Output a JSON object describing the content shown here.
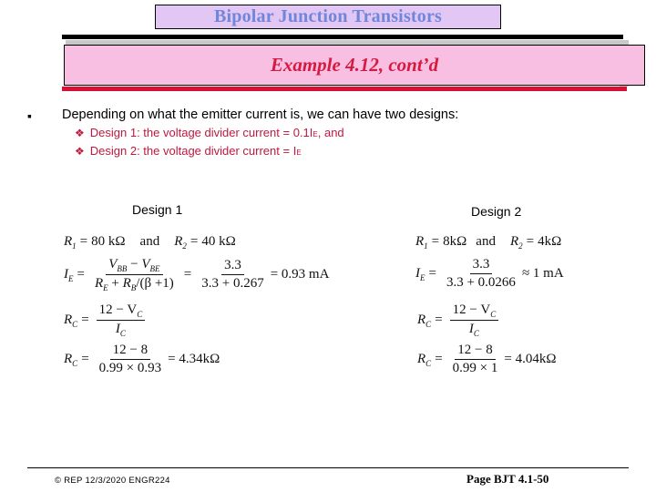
{
  "slide": {
    "title": "Bipolar Junction Transistors",
    "subtitle": "Example 4.12, cont’d",
    "colors": {
      "title_box_bg": "#e2c6f4",
      "title_text": "#6f86d9",
      "subtitle_box_bg": "#f9bfe3",
      "subtitle_text": "#d41a3f",
      "accent_rule": "#d90f33",
      "sub_bullet_text": "#c0183e"
    }
  },
  "body": {
    "main_bullet": {
      "icon": "square-bullet",
      "glyph": "▪",
      "text": "Depending on what the emitter current is, we can have two designs:"
    },
    "sub_bullets": [
      {
        "icon": "diamond-bullet",
        "glyph": "❖",
        "text": "Design 1:  the voltage divider current = 0.1I",
        "sub": "E",
        "suffix": ", and"
      },
      {
        "icon": "diamond-bullet",
        "glyph": "❖",
        "text": "Design 2:  the voltage divider current = I",
        "sub": "E",
        "suffix": ""
      }
    ]
  },
  "design1": {
    "heading": "Design 1",
    "r1": "80 kΩ",
    "and": "and",
    "r2": "40 kΩ",
    "ie_numerator": "V",
    "ie_num_sub1": "BB",
    "ie_num_sub2": "BE",
    "ie_denominator_a": "R",
    "ie_den_sub1": "E",
    "ie_den_sub2": "B",
    "ie_den_tail": "/(β +1)",
    "ie_value_num": "3.3",
    "ie_value_den": "3.3 + 0.267",
    "ie_result": "= 0.93 mA",
    "rc_formula_num": "12 − V",
    "rc_formula_den": "I",
    "rc_value_num": "12 − 8",
    "rc_value_den": "0.99 × 0.93",
    "rc_result": "= 4.34kΩ"
  },
  "design2": {
    "heading": "Design 2",
    "r1": "8kΩ",
    "and": "and",
    "r2": "4kΩ",
    "ie_value_num": "3.3",
    "ie_value_den": "3.3 + 0.0266",
    "ie_result": "≈ 1 mA",
    "rc_formula_num": "12 − V",
    "rc_formula_den": "I",
    "rc_value_num": "12 − 8",
    "rc_value_den": "0.99 × 1",
    "rc_result": "= 4.04kΩ"
  },
  "footer": {
    "left": "© REP  12/3/2020  ENGR224",
    "right": "Page BJT 4.1-50"
  },
  "symbols": {
    "R": "R",
    "I": "I",
    "V": "V",
    "eq": "=",
    "sub_1": "1",
    "sub_2": "2",
    "sub_E": "E",
    "sub_C": "C",
    "minus": "−",
    "plus": "+"
  }
}
